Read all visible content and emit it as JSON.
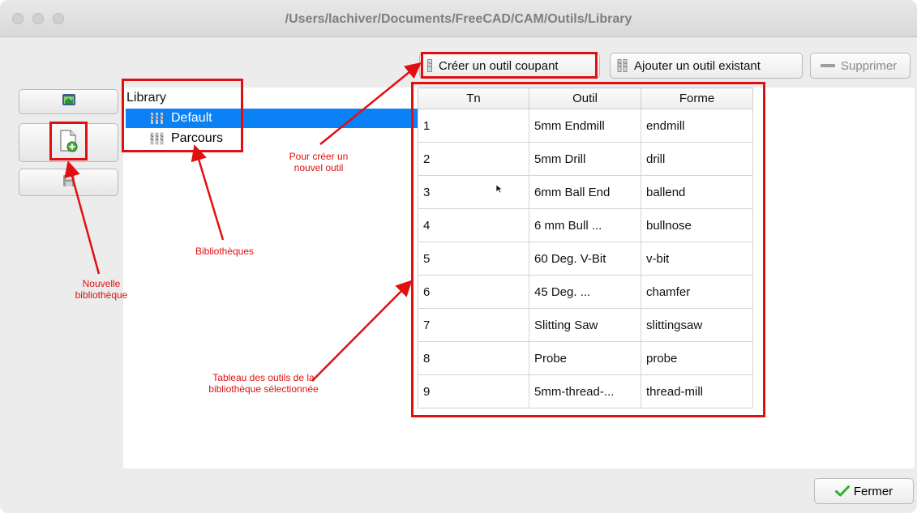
{
  "window": {
    "title": "/Users/lachiver/Documents/FreeCAD/CAM/Outils/Library"
  },
  "toolbar": {
    "create_label": "Créer un outil coupant",
    "add_label": "Ajouter un outil existant",
    "delete_label": "Supprimer"
  },
  "tree": {
    "header": "Library",
    "items": [
      {
        "label": "Default",
        "selected": true
      },
      {
        "label": "Parcours",
        "selected": false
      }
    ]
  },
  "table": {
    "headers": [
      "Tn",
      "Outil",
      "Forme"
    ],
    "rows": [
      {
        "tn": "1",
        "outil": "5mm Endmill",
        "forme": "endmill"
      },
      {
        "tn": "2",
        "outil": "5mm Drill",
        "forme": "drill"
      },
      {
        "tn": "3",
        "outil": "6mm Ball End",
        "forme": "ballend"
      },
      {
        "tn": "4",
        "outil": "6 mm Bull ...",
        "forme": "bullnose"
      },
      {
        "tn": "5",
        "outil": "60 Deg. V-Bit",
        "forme": "v-bit"
      },
      {
        "tn": "6",
        "outil": "45 Deg. ...",
        "forme": "chamfer"
      },
      {
        "tn": "7",
        "outil": "Slitting Saw",
        "forme": "slittingsaw"
      },
      {
        "tn": "8",
        "outil": "Probe",
        "forme": "probe"
      },
      {
        "tn": "9",
        "outil": "5mm-thread-...",
        "forme": "thread-mill"
      }
    ]
  },
  "footer": {
    "close_label": "Fermer"
  },
  "annotations": {
    "create_tool": "Pour créer un nouvel outil",
    "libraries": "Bibliothèques",
    "new_library": "Nouvelle bibliothèque",
    "tools_table": "Tableau des outils de la bibliothèque sélectionnée"
  },
  "colors": {
    "selection": "#0a82f5",
    "annotation": "#e01010",
    "check_green": "#2fb12f"
  },
  "icons": {
    "open_library": "folder-open-icon",
    "new_library": "new-document-plus-icon",
    "save_library": "save-disk-icon",
    "tool_bit": "tool-bit-icon",
    "tool_bits_multi": "tool-bits-icon",
    "remove": "minus-icon",
    "check": "checkmark-icon"
  }
}
